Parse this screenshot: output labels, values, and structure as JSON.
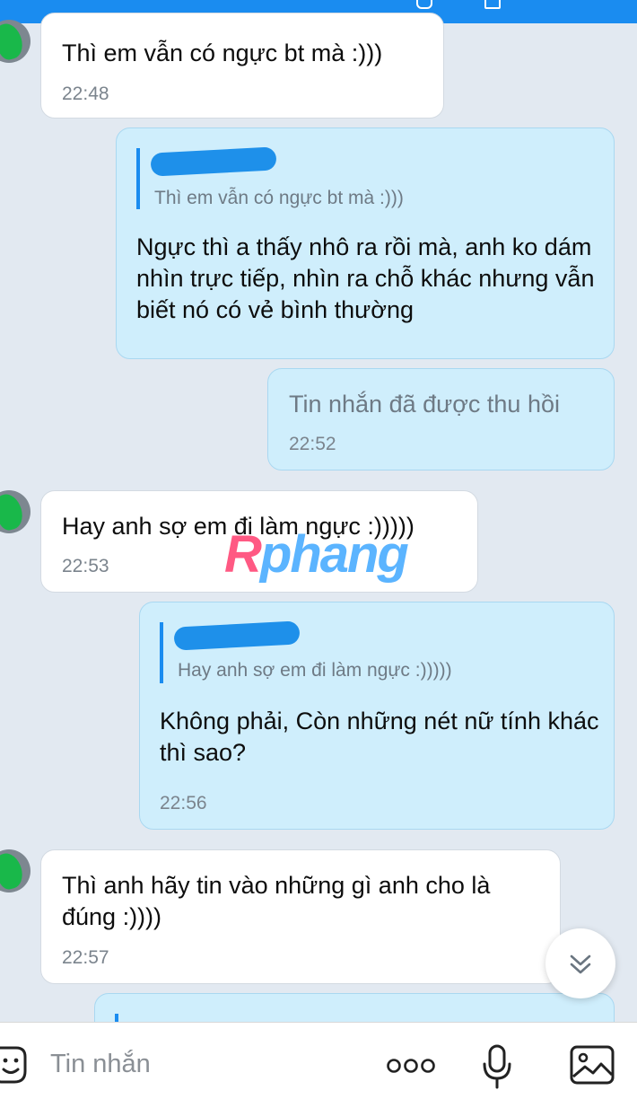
{
  "conversation": {
    "messages": [
      {
        "text": "Thì em vẫn có ngực bt mà :)))",
        "time": "22:48"
      },
      {
        "quote_text": "Thì em vẫn có ngực bt mà :)))",
        "text": "Ngực thì a thấy nhô ra rồi mà, anh ko dám nhìn trực tiếp, nhìn ra chỗ khác nhưng vẫn biết nó có vẻ bình thường"
      },
      {
        "text": "Tin nhắn đã được thu hồi",
        "time": "22:52"
      },
      {
        "text": "Hay anh sợ em đi làm ngực :)))))",
        "time": "22:53"
      },
      {
        "quote_text": "Hay anh sợ em đi làm ngực :)))))",
        "text": "Không phải, Còn những nét nữ tính khác thì sao?",
        "time": "22:56"
      },
      {
        "text": "Thì anh hãy tin vào những gì anh cho là đúng :))))",
        "time": "22:57"
      }
    ]
  },
  "watermark": {
    "first": "R",
    "rest": "phang"
  },
  "input": {
    "placeholder": "Tin nhắn"
  },
  "icons": {
    "sticker": "smile-sticker-icon",
    "more": "more-options-icon",
    "mic": "microphone-icon",
    "image": "image-gallery-icon",
    "scroll": "chevron-double-down-icon"
  },
  "colors": {
    "accent": "#1a8cf0",
    "outgoing_bubble": "#cfeefc",
    "incoming_bubble": "#ffffff",
    "background": "#e2e9f1"
  }
}
